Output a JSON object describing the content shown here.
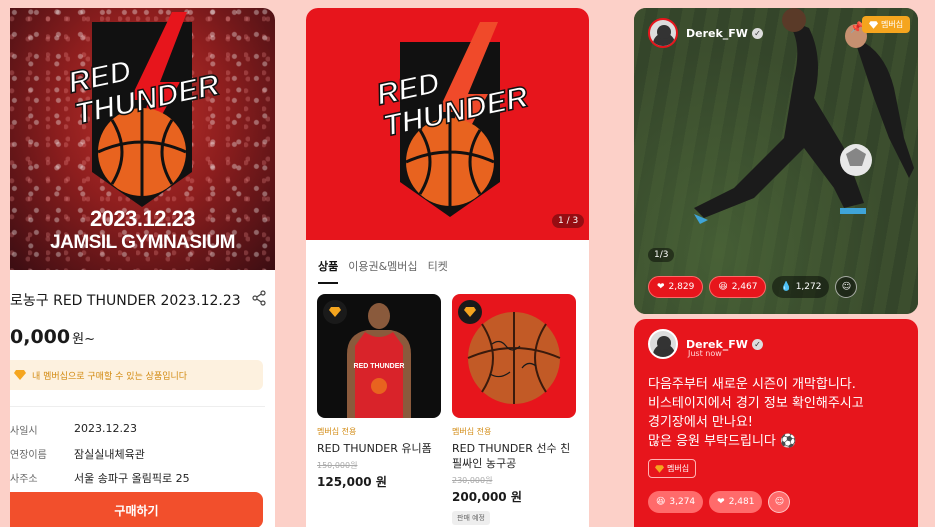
{
  "panel1": {
    "hero_logo_line1": "RED",
    "hero_logo_line2": "THUNDER",
    "hero_date": "2023.12.23",
    "hero_venue": "JAMSIL GYMNASIUM",
    "title": "로농구 RED THUNDER 2023.12.23",
    "price": "0,000",
    "price_unit": "원~",
    "member_notice": "내 멤버십으로 구매할 수 있는 상품입니다",
    "info": [
      {
        "key": "사일시",
        "value": "2023.12.23"
      },
      {
        "key": "연장이름",
        "value": "잠실실내체육관"
      },
      {
        "key": "사주소",
        "value": "서울 송파구 올림픽로 25"
      }
    ],
    "buy_button": "구매하기"
  },
  "panel2": {
    "hero_logo_line1": "RED",
    "hero_logo_line2": "THUNDER",
    "image_counter": "1 / 3",
    "tabs": [
      "상품",
      "이용권&멤버십",
      "티켓"
    ],
    "products": [
      {
        "tag": "멤버십 전용",
        "name": "RED THUNDER 유니폼",
        "original_price": "150,000원",
        "price": "125,000 원",
        "status": ""
      },
      {
        "tag": "멤버십 전용",
        "name": "RED THUNDER 선수 친필싸인 농구공",
        "original_price": "230,000원",
        "price": "200,000 원",
        "status": "판매 예정"
      }
    ],
    "jersey_text": "RED THUNDER"
  },
  "panel3": {
    "username": "Derek_FW",
    "member_badge": "멤버십",
    "image_counter": "1/3",
    "reactions": [
      {
        "icon": "heart-icon",
        "count": "2,829"
      },
      {
        "icon": "laugh-emoji-icon",
        "count": "2,467"
      },
      {
        "icon": "drop-icon",
        "count": "1,272"
      }
    ]
  },
  "panel4": {
    "username": "Derek_FW",
    "time": "Just now",
    "post_lines": [
      "다음주부터 새로운 시즌이 개막합니다.",
      "비스테이지에서 경기 정보 확인해주시고",
      "경기장에서 만나요!",
      "많은 응원 부탁드립니다 ⚽"
    ],
    "member_badge": "멤버십",
    "reactions": [
      {
        "icon": "laugh-emoji-icon",
        "count": "3,274"
      },
      {
        "icon": "heart-icon",
        "count": "2,481"
      }
    ]
  },
  "colors": {
    "brand_red": "#e7151c",
    "accent_orange": "#f24f2c",
    "gold": "#f5a51e",
    "background": "#fcd0c8"
  }
}
